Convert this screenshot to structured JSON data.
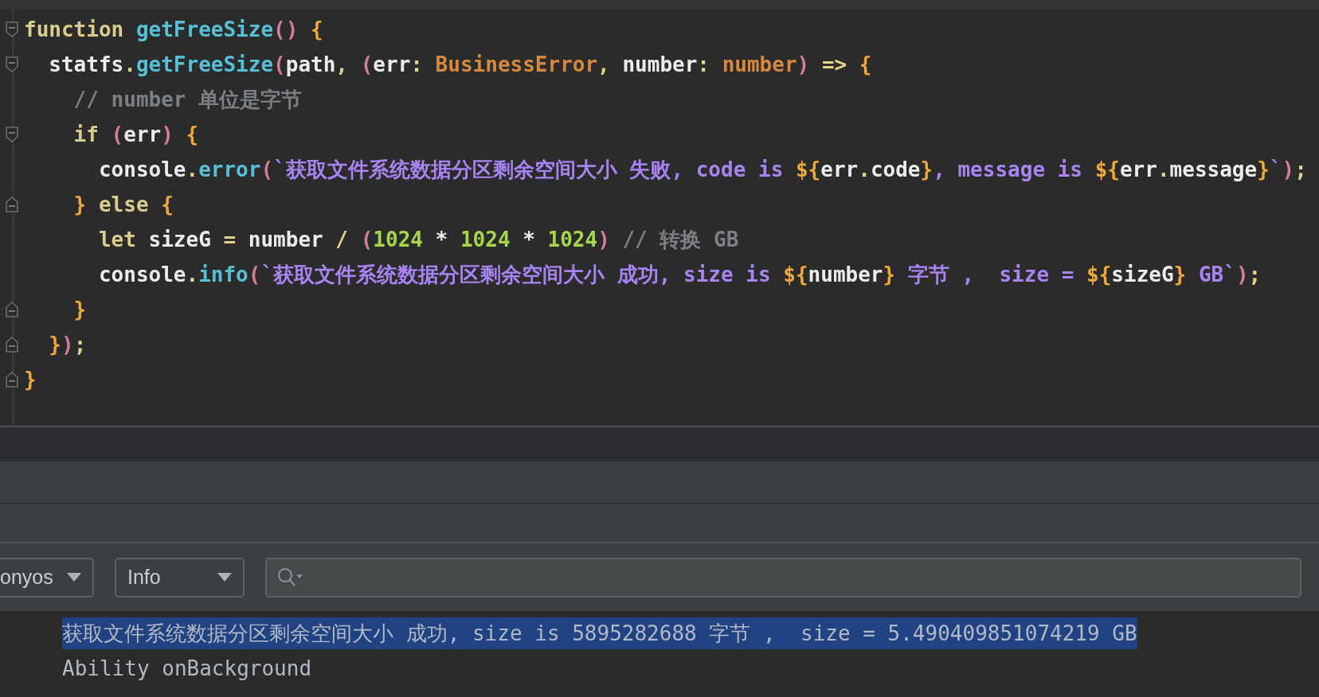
{
  "editor": {
    "lines": [
      {
        "kind": "fold-start",
        "tokens": [
          {
            "kind": "kw",
            "t": "function "
          },
          {
            "kind": "fn",
            "t": "getFreeSize"
          },
          {
            "kind": "paren",
            "t": "() "
          },
          {
            "kind": "brace",
            "t": "{"
          }
        ]
      },
      {
        "kind": "fold-start",
        "tokens": [
          {
            "kind": "plain",
            "t": "  statfs"
          },
          {
            "kind": "op",
            "t": "."
          },
          {
            "kind": "fn",
            "t": "getFreeSize"
          },
          {
            "kind": "paren",
            "t": "("
          },
          {
            "kind": "plain",
            "t": "path"
          },
          {
            "kind": "op",
            "t": ", "
          },
          {
            "kind": "paren",
            "t": "("
          },
          {
            "kind": "plain",
            "t": "err"
          },
          {
            "kind": "op",
            "t": ": "
          },
          {
            "kind": "type",
            "t": "BusinessError"
          },
          {
            "kind": "op",
            "t": ", "
          },
          {
            "kind": "plain",
            "t": "number"
          },
          {
            "kind": "op",
            "t": ": "
          },
          {
            "kind": "type",
            "t": "number"
          },
          {
            "kind": "paren",
            "t": ")"
          },
          {
            "kind": "op",
            "t": " => "
          },
          {
            "kind": "brace",
            "t": "{"
          }
        ]
      },
      {
        "kind": "plain",
        "tokens": [
          {
            "kind": "comment",
            "t": "    // number 单位是字节"
          }
        ]
      },
      {
        "kind": "fold-start",
        "tokens": [
          {
            "kind": "kw",
            "t": "    if "
          },
          {
            "kind": "paren",
            "t": "("
          },
          {
            "kind": "plain",
            "t": "err"
          },
          {
            "kind": "paren",
            "t": ") "
          },
          {
            "kind": "brace",
            "t": "{"
          }
        ]
      },
      {
        "kind": "plain",
        "tokens": [
          {
            "kind": "plain",
            "t": "      console"
          },
          {
            "kind": "op",
            "t": "."
          },
          {
            "kind": "fn",
            "t": "error"
          },
          {
            "kind": "paren",
            "t": "("
          },
          {
            "kind": "str",
            "t": "`获取文件系统数据分区剩余空间大小 失败, code is "
          },
          {
            "kind": "brace",
            "t": "${"
          },
          {
            "kind": "plain",
            "t": "err"
          },
          {
            "kind": "op",
            "t": "."
          },
          {
            "kind": "plain",
            "t": "code"
          },
          {
            "kind": "brace",
            "t": "}"
          },
          {
            "kind": "str",
            "t": ", message is "
          },
          {
            "kind": "brace",
            "t": "${"
          },
          {
            "kind": "plain",
            "t": "err"
          },
          {
            "kind": "op",
            "t": "."
          },
          {
            "kind": "plain",
            "t": "message"
          },
          {
            "kind": "brace",
            "t": "}"
          },
          {
            "kind": "str",
            "t": "`"
          },
          {
            "kind": "paren",
            "t": ")"
          },
          {
            "kind": "op",
            "t": ";"
          }
        ]
      },
      {
        "kind": "fold-end",
        "tokens": [
          {
            "kind": "brace",
            "t": "    } "
          },
          {
            "kind": "kw",
            "t": "else "
          },
          {
            "kind": "brace",
            "t": "{"
          }
        ]
      },
      {
        "kind": "plain",
        "tokens": [
          {
            "kind": "kw",
            "t": "      let"
          },
          {
            "kind": "plain",
            "t": " sizeG "
          },
          {
            "kind": "op",
            "t": "="
          },
          {
            "kind": "plain",
            "t": " number "
          },
          {
            "kind": "op",
            "t": "/ "
          },
          {
            "kind": "paren",
            "t": "("
          },
          {
            "kind": "num",
            "t": "1024"
          },
          {
            "kind": "plain",
            "t": " * "
          },
          {
            "kind": "num",
            "t": "1024"
          },
          {
            "kind": "plain",
            "t": " * "
          },
          {
            "kind": "num",
            "t": "1024"
          },
          {
            "kind": "paren",
            "t": ") "
          },
          {
            "kind": "comment",
            "t": "// 转换 GB"
          }
        ]
      },
      {
        "kind": "plain",
        "tokens": [
          {
            "kind": "plain",
            "t": "      console"
          },
          {
            "kind": "op",
            "t": "."
          },
          {
            "kind": "fn",
            "t": "info"
          },
          {
            "kind": "paren",
            "t": "("
          },
          {
            "kind": "str",
            "t": "`获取文件系统数据分区剩余空间大小 成功, size is "
          },
          {
            "kind": "brace",
            "t": "${"
          },
          {
            "kind": "plain",
            "t": "number"
          },
          {
            "kind": "brace",
            "t": "}"
          },
          {
            "kind": "str",
            "t": " 字节 ,  size = "
          },
          {
            "kind": "brace",
            "t": "${"
          },
          {
            "kind": "plain",
            "t": "sizeG"
          },
          {
            "kind": "brace",
            "t": "}"
          },
          {
            "kind": "str",
            "t": " GB`"
          },
          {
            "kind": "paren",
            "t": ")"
          },
          {
            "kind": "op",
            "t": ";"
          }
        ]
      },
      {
        "kind": "fold-end",
        "tokens": [
          {
            "kind": "brace",
            "t": "    }"
          }
        ]
      },
      {
        "kind": "fold-end",
        "tokens": [
          {
            "kind": "brace",
            "t": "  }"
          },
          {
            "kind": "paren",
            "t": ")"
          },
          {
            "kind": "op",
            "t": ";"
          }
        ]
      },
      {
        "kind": "fold-end",
        "tokens": [
          {
            "kind": "brace",
            "t": "}"
          }
        ]
      }
    ]
  },
  "log_filters": {
    "process": "onyos",
    "level": "Info"
  },
  "log": [
    {
      "text": "获取文件系统数据分区剩余空间大小 成功, size is 5895282688 字节 ,  size = 5.490409851074219 GB",
      "selected": true
    },
    {
      "text": "Ability onBackground",
      "selected": false
    }
  ]
}
